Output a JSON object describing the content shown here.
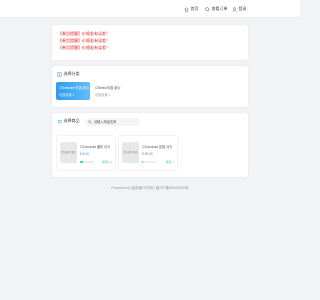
{
  "nav": {
    "home": "首页",
    "orders": "查看订单",
    "login": "登录"
  },
  "notices": [
    "【卷旨提醒】价格若有误差！",
    "【卷旨提醒】价格若有误差！",
    "【卷旨提醒】价格若有误差！"
  ],
  "categories": {
    "title": "选择分类",
    "items": [
      {
        "name": "CStelecled 可选 原价",
        "sub": "可选设置 1"
      },
      {
        "name": "CStelecl可选 原价",
        "sub": "可选设置 1"
      }
    ]
  },
  "products": {
    "title": "选择商品",
    "search_placeholder": "请输入商品名称",
    "image_placeholder": "默认图片预览",
    "items": [
      {
        "title": "CS/android 通讯 月卡",
        "price": "¥ 8.00",
        "stock": "库存 11",
        "stock_level": 0.2
      },
      {
        "title": "CS/android 定制 月卡",
        "price": "¥ 92.00",
        "stock": "库存 1",
        "stock_level": 0.05
      }
    ]
  },
  "footer": {
    "powered_by": "Powered by 独角兽代付网",
    "icp": "备ICP备00000000号"
  },
  "colors": {
    "accent": "#2f9bf0",
    "notice": "#e1251b",
    "stock": "#3ccfa2"
  }
}
